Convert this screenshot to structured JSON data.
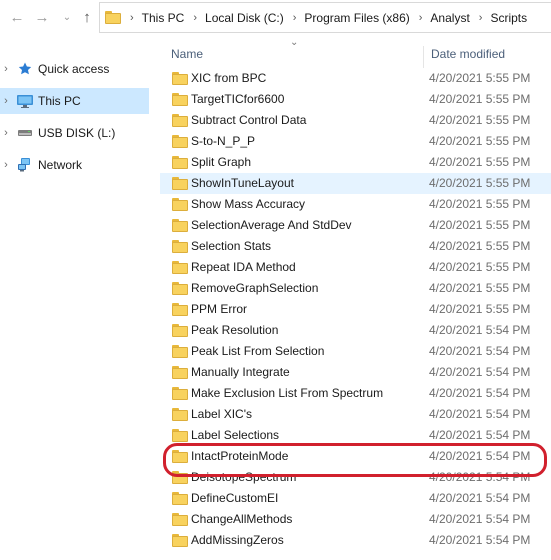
{
  "window": {
    "address": {
      "crumbs": [
        "This PC",
        "Local Disk (C:)",
        "Program Files (x86)",
        "Analyst",
        "Scripts"
      ]
    }
  },
  "nav": {
    "back_icon": "arrow-left-icon",
    "forward_icon": "arrow-right-icon",
    "recent_icon": "chevron-down-icon",
    "up_icon": "arrow-up-icon",
    "items": [
      {
        "label": "Quick access",
        "icon": "star-icon"
      },
      {
        "label": "This PC",
        "icon": "monitor-icon",
        "selected": true
      },
      {
        "label": "USB DISK (L:)",
        "icon": "usb-drive-icon"
      },
      {
        "label": "Network",
        "icon": "network-icon"
      }
    ]
  },
  "list": {
    "columns": {
      "name": "Name",
      "date": "Date modified"
    },
    "files": [
      {
        "name": "XIC from BPC",
        "date": "4/20/2021 5:55 PM"
      },
      {
        "name": "TargetTICfor6600",
        "date": "4/20/2021 5:55 PM"
      },
      {
        "name": "Subtract Control Data",
        "date": "4/20/2021 5:55 PM"
      },
      {
        "name": "S-to-N_P_P",
        "date": "4/20/2021 5:55 PM"
      },
      {
        "name": "Split Graph",
        "date": "4/20/2021 5:55 PM"
      },
      {
        "name": "ShowInTuneLayout",
        "date": "4/20/2021 5:55 PM"
      },
      {
        "name": "Show Mass Accuracy",
        "date": "4/20/2021 5:55 PM"
      },
      {
        "name": "SelectionAverage And StdDev",
        "date": "4/20/2021 5:55 PM"
      },
      {
        "name": "Selection Stats",
        "date": "4/20/2021 5:55 PM"
      },
      {
        "name": "Repeat IDA Method",
        "date": "4/20/2021 5:55 PM"
      },
      {
        "name": "RemoveGraphSelection",
        "date": "4/20/2021 5:55 PM"
      },
      {
        "name": "PPM Error",
        "date": "4/20/2021 5:55 PM"
      },
      {
        "name": "Peak Resolution",
        "date": "4/20/2021 5:54 PM"
      },
      {
        "name": "Peak List From Selection",
        "date": "4/20/2021 5:54 PM"
      },
      {
        "name": "Manually Integrate",
        "date": "4/20/2021 5:54 PM"
      },
      {
        "name": "Make Exclusion List From Spectrum",
        "date": "4/20/2021 5:54 PM"
      },
      {
        "name": "Label XIC's",
        "date": "4/20/2021 5:54 PM"
      },
      {
        "name": "Label Selections",
        "date": "4/20/2021 5:54 PM"
      },
      {
        "name": "IntactProteinMode",
        "date": "4/20/2021 5:54 PM"
      },
      {
        "name": "DeisotopeSpectrum",
        "date": "4/20/2021 5:54 PM"
      },
      {
        "name": "DefineCustomEI",
        "date": "4/20/2021 5:54 PM"
      },
      {
        "name": "ChangeAllMethods",
        "date": "4/20/2021 5:54 PM"
      },
      {
        "name": "AddMissingZeros",
        "date": "4/20/2021 5:54 PM"
      }
    ],
    "hovered": "ShowInTuneLayout",
    "highlighted": "IntactProteinMode"
  },
  "colors": {
    "accent": "#cce8ff",
    "hover": "#e5f3ff",
    "highlight": "#d1202d",
    "folder": "#f8d25e"
  }
}
